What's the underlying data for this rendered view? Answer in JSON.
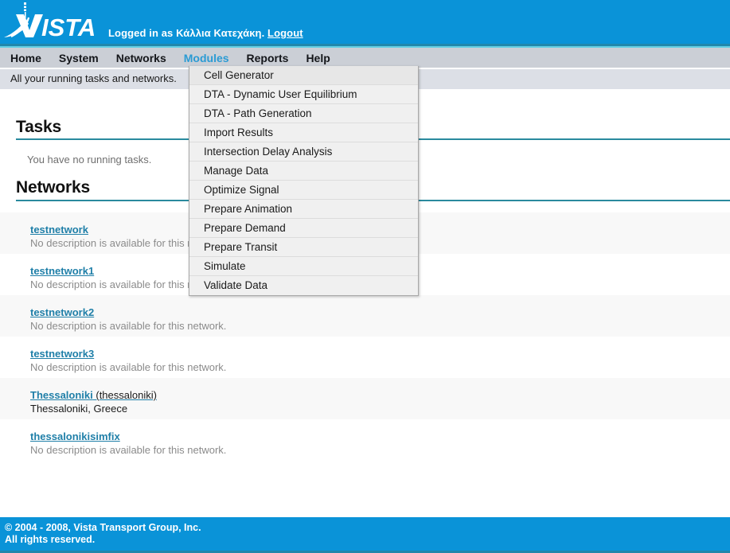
{
  "header": {
    "logo_text": "VISTA",
    "logo_icon": "vista-swoosh-logo",
    "login_prefix": "Logged in as ",
    "user_name": "Κάλλια Κατεχάκη.",
    "logout_label": "Logout",
    "brand_color": "#0a93d8"
  },
  "nav": {
    "items": [
      {
        "label": "Home",
        "active": false
      },
      {
        "label": "System",
        "active": false
      },
      {
        "label": "Networks",
        "active": false
      },
      {
        "label": "Modules",
        "active": true
      },
      {
        "label": "Reports",
        "active": false
      },
      {
        "label": "Help",
        "active": false
      }
    ],
    "active_color": "#2a9bd4"
  },
  "subtitle": {
    "text": "All your running tasks and networks."
  },
  "dropdown": {
    "owner": "Modules",
    "items": [
      "Cell Generator",
      "DTA - Dynamic User Equilibrium",
      "DTA - Path Generation",
      "Import Results",
      "Intersection Delay Analysis",
      "Manage Data",
      "Optimize Signal",
      "Prepare Animation",
      "Prepare Demand",
      "Prepare Transit",
      "Simulate",
      "Validate Data"
    ]
  },
  "tasks": {
    "heading": "Tasks",
    "empty_message": "You have no running tasks."
  },
  "networks": {
    "heading": "Networks",
    "rule_color": "#2a8a9e",
    "items": [
      {
        "name": "testnetwork",
        "alias": "",
        "description": "No description is available for this network.",
        "dark_desc": false
      },
      {
        "name": "testnetwork1",
        "alias": "",
        "description": "No description is available for this network.",
        "dark_desc": false
      },
      {
        "name": "testnetwork2",
        "alias": "",
        "description": "No description is available for this network.",
        "dark_desc": false
      },
      {
        "name": "testnetwork3",
        "alias": "",
        "description": "No description is available for this network.",
        "dark_desc": false
      },
      {
        "name": "Thessaloniki",
        "alias": " (thessaloniki)",
        "description": "Thessaloniki, Greece",
        "dark_desc": true
      },
      {
        "name": "thessalonikisimfix",
        "alias": "",
        "description": "No description is available for this network.",
        "dark_desc": false
      }
    ]
  },
  "footer": {
    "line1": "© 2004 - 2008, Vista Transport Group, Inc.",
    "line2": "All rights reserved."
  }
}
